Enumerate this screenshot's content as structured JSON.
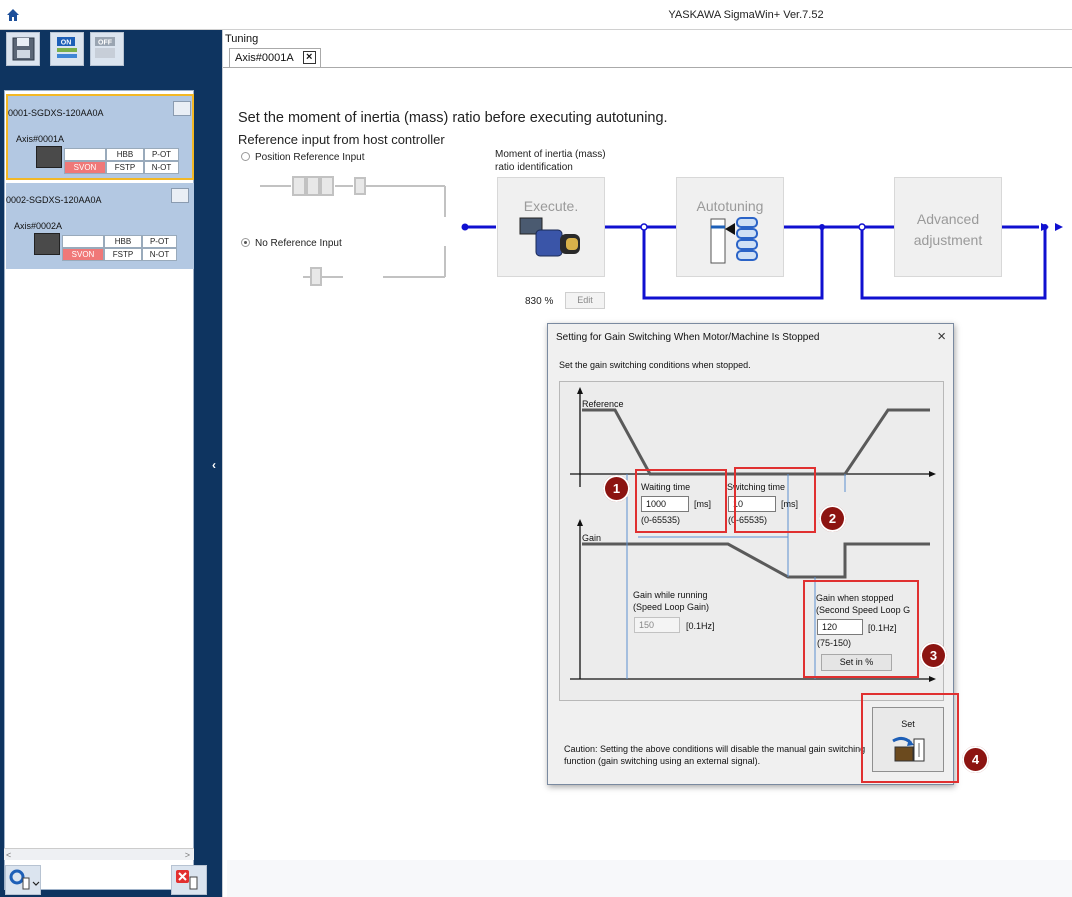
{
  "app": {
    "title": "YASKAWA SigmaWin+ Ver.7.52"
  },
  "sidebar": {
    "toolbar": [
      {
        "name": "save",
        "icon": "floppy-disk-icon"
      },
      {
        "name": "servo-on",
        "label": "ON",
        "icon": "servo-on-icon"
      },
      {
        "name": "servo-off",
        "label": "OFF",
        "icon": "servo-off-icon"
      }
    ],
    "devices": [
      {
        "name": "0001-SGDXS-120AA0A",
        "axis": "Axis#0001A",
        "status": {
          "svon": "SVON",
          "hbb": "HBB",
          "fstp": "FSTP",
          "pot": "P-OT",
          "not": "N-OT"
        },
        "selected": true
      },
      {
        "name": "0002-SGDXS-120AA0A",
        "axis": "Axis#0002A",
        "status": {
          "svon": "SVON",
          "hbb": "HBB",
          "fstp": "FSTP",
          "pot": "P-OT",
          "not": "N-OT"
        },
        "selected": false
      }
    ]
  },
  "main": {
    "section": "Tuning",
    "tab": "Axis#0001A",
    "instruction": "Set the moment of inertia (mass) ratio before executing autotuning.",
    "reference_heading": "Reference input from host controller",
    "radio_position": "Position Reference Input",
    "radio_none": "No Reference Input",
    "moi_label_line1": "Moment of inertia (mass)",
    "moi_label_line2": "ratio identification",
    "execute": "Execute.",
    "autotuning": "Autotuning",
    "advanced_line1": "Advanced",
    "advanced_line2": "adjustment",
    "inertia_percent": "830 %",
    "edit": "Edit"
  },
  "dialog": {
    "title": "Setting for Gain Switching When Motor/Machine Is Stopped",
    "subtitle": "Set the gain switching conditions when stopped.",
    "reference_label": "Reference",
    "gain_label": "Gain",
    "waiting_time": {
      "label": "Waiting time",
      "value": "1000",
      "unit": "[ms]",
      "range": "(0-65535)"
    },
    "switching_time": {
      "label": "Switching time",
      "value": "10",
      "unit": "[ms]",
      "range": "(0-65535)"
    },
    "gain_running": {
      "label1": "Gain while running",
      "label2": "(Speed Loop Gain)",
      "value": "150",
      "unit": "[0.1Hz]"
    },
    "gain_stopped": {
      "label1": "Gain when stopped",
      "label2": "(Second Speed Loop G",
      "value": "120",
      "unit": "[0.1Hz]",
      "range": "(75-150)"
    },
    "set_in_percent": "Set in %",
    "set": "Set",
    "caution_line1": "Caution: Setting the above conditions will disable the manual gain switching",
    "caution_line2": "function (gain switching using an external signal)."
  },
  "callouts": [
    "1",
    "2",
    "3",
    "4"
  ],
  "colors": {
    "sidebar_bg": "#0e3460",
    "device_card": "#b3c8e2",
    "selected_border": "#f3b825",
    "flow_line": "#1010d0",
    "callout_badge": "#8c1411",
    "callout_box": "#e03030",
    "svon_red": "#f07878"
  }
}
